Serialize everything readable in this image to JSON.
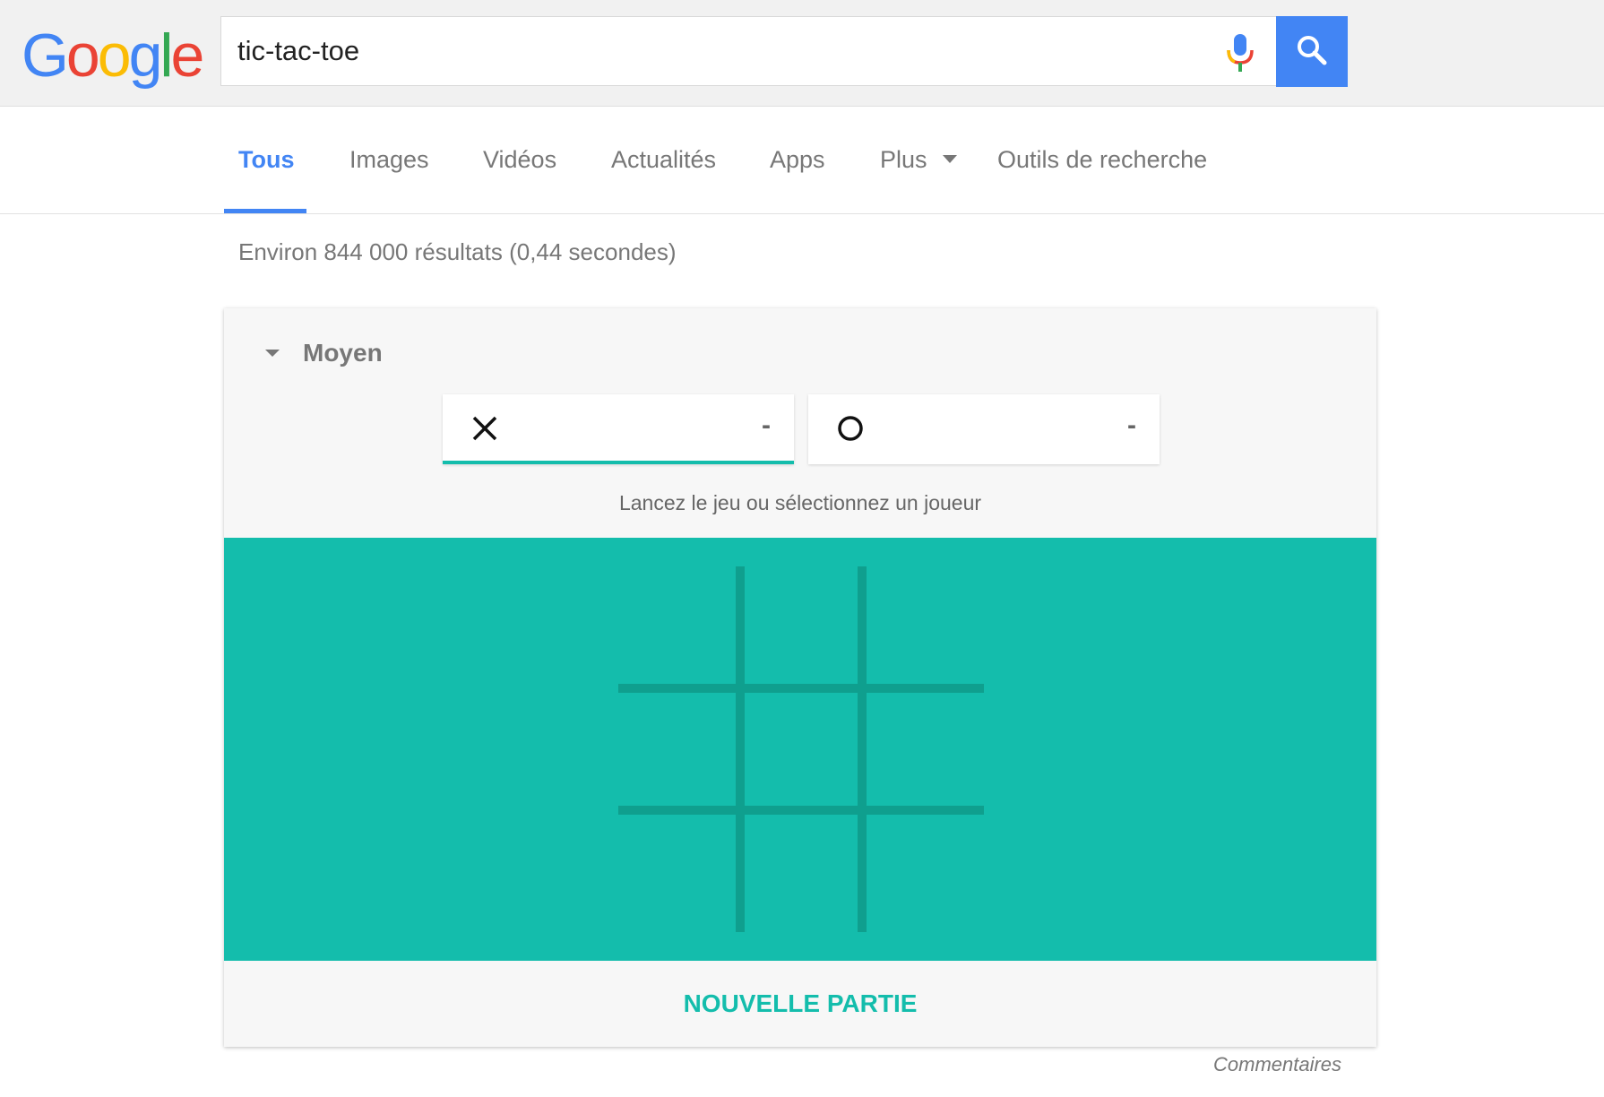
{
  "header": {
    "logo_letters": [
      {
        "char": "G",
        "color": "#4285f4"
      },
      {
        "char": "o",
        "color": "#ea4335"
      },
      {
        "char": "o",
        "color": "#fbbc05"
      },
      {
        "char": "g",
        "color": "#4285f4"
      },
      {
        "char": "l",
        "color": "#34a853"
      },
      {
        "char": "e",
        "color": "#ea4335"
      }
    ],
    "search_value": "tic-tac-toe",
    "mic_icon": "microphone-icon",
    "search_icon": "magnifier-icon",
    "search_button_color": "#4285f4"
  },
  "tabs": {
    "all": "Tous",
    "images": "Images",
    "videos": "Vidéos",
    "news": "Actualités",
    "apps": "Apps",
    "more": "Plus",
    "tools": "Outils de recherche",
    "active_color": "#4285f4"
  },
  "result_stats": "Environ 844 000 résultats (0,44 secondes)",
  "game": {
    "difficulty": "Moyen",
    "player_x": {
      "symbol": "X",
      "score": "-"
    },
    "player_o": {
      "symbol": "O",
      "score": "-"
    },
    "hint": "Lancez le jeu ou sélectionnez un joueur",
    "board_color": "#14bdac",
    "grid_line_color": "#0f9f8e",
    "cells": [
      "",
      "",
      "",
      "",
      "",
      "",
      "",
      "",
      ""
    ],
    "new_game_label": "NOUVELLE PARTIE"
  },
  "feedback": "Commentaires"
}
